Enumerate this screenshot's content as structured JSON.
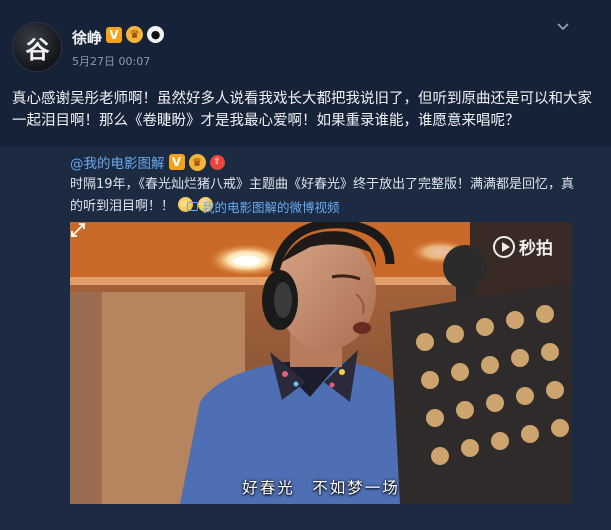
{
  "post": {
    "avatar_glyph": "谷",
    "username": "徐峥",
    "badges": [
      "V",
      "♛",
      "●"
    ],
    "timestamp": "5月27日 00:07",
    "text": "真心感谢吴彤老师啊！虽然好多人说看我戏长大都把我说旧了，但听到原曲还是可以和大家一起泪目啊！那么《卷睫盼》才是我最心爱啊！如果重录谁能，谁愿意来唱呢？"
  },
  "repost": {
    "user": "@我的电影图解",
    "text": "时隔19年，《春光灿烂猪八戒》主题曲《好春光》终于放出了完整版！满满都是回忆，真的听到泪目啊！！",
    "video_link_label": "我的电影图解的微博视频",
    "video": {
      "watermark": "秒拍",
      "subtitle": "好春光　不如梦一场"
    }
  },
  "colors": {
    "background": "#152238",
    "repost_background": "#1c2b42",
    "link": "#6aa9ef",
    "vip_badge": "#f7a21b"
  }
}
